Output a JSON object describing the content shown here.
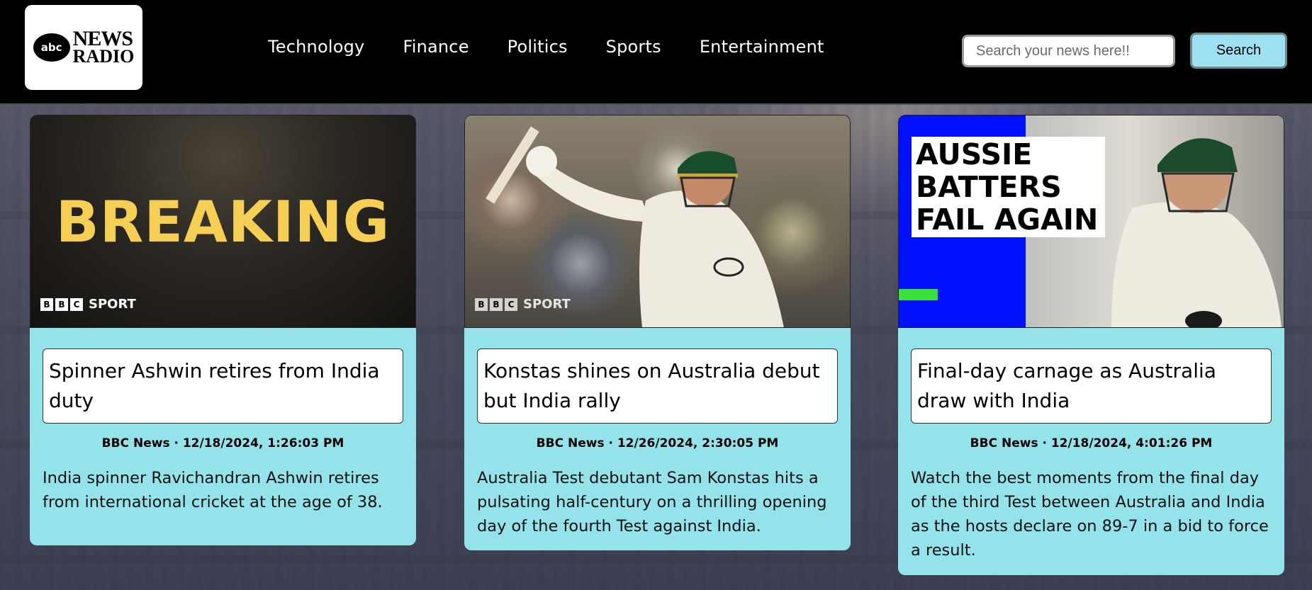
{
  "header": {
    "logo": {
      "abc": "abc",
      "line1": "NEWS",
      "line2": "RADIO"
    },
    "nav": [
      "Technology",
      "Finance",
      "Politics",
      "Sports",
      "Entertainment"
    ],
    "search": {
      "placeholder": "Search your news here!!",
      "button_label": "Search"
    }
  },
  "cards": [
    {
      "image": {
        "headline": "BREAKING",
        "brand_letters": [
          "B",
          "B",
          "C"
        ],
        "brand_label": "SPORT"
      },
      "title": "Spinner Ashwin retires from India duty",
      "meta": "BBC News · 12/18/2024, 1:26:03 PM",
      "description": "India spinner Ravichandran Ashwin retires from international cricket at the age of 38."
    },
    {
      "image": {
        "brand_letters": [
          "B",
          "B",
          "C"
        ],
        "brand_label": "SPORT"
      },
      "title": "Konstas shines on Australia debut but India rally",
      "meta": "BBC News · 12/26/2024, 2:30:05 PM",
      "description": "Australia Test debutant Sam Konstas hits a pulsating half-century on a thrilling opening day of the fourth Test against India."
    },
    {
      "image": {
        "headline_lines": [
          "AUSSIE",
          "BATTERS",
          "FAIL AGAIN"
        ]
      },
      "title": "Final-day carnage as Australia draw with India",
      "meta": "BBC News · 12/18/2024, 4:01:26 PM",
      "description": "Watch the best moments from the final day of the third Test between Australia and India as the hosts declare on 89-7 in a bid to force a result."
    }
  ],
  "colors": {
    "header_bg": "#000000",
    "card_bg": "#95e3ea",
    "search_button_bg": "#9ee1f2",
    "breaking_yellow": "#f5cf55",
    "scoreboard_blue": "#0010ff"
  }
}
